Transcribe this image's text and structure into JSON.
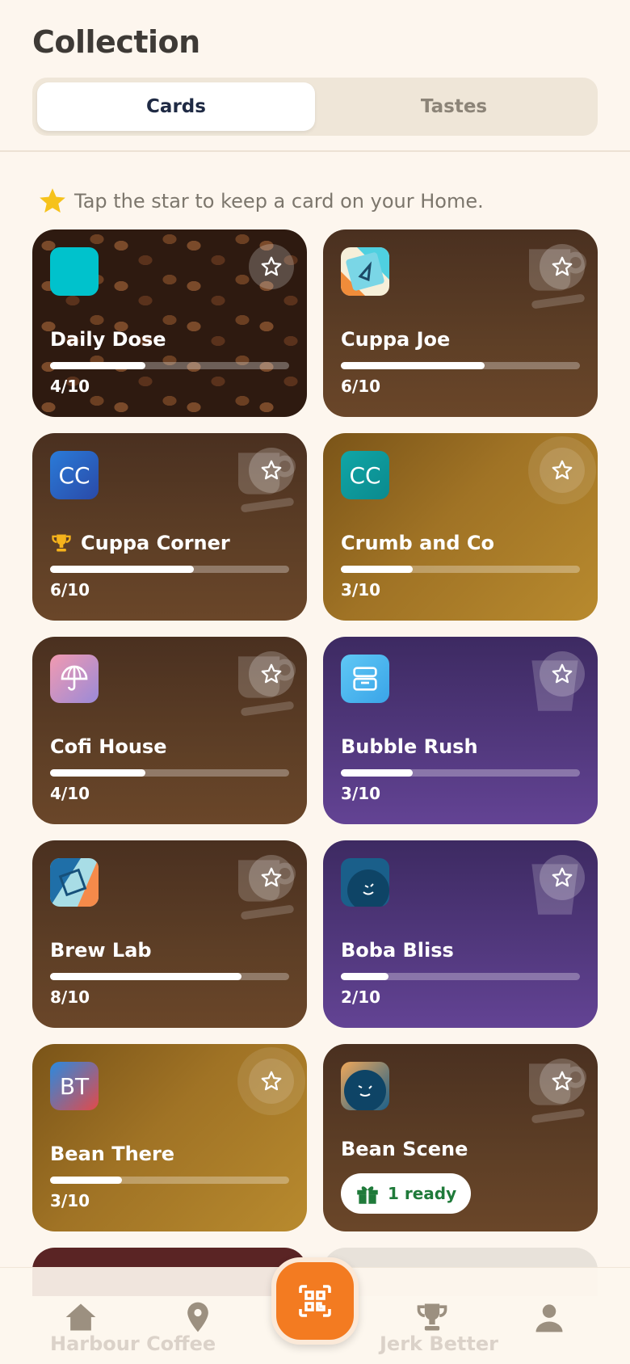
{
  "header": {
    "title": "Collection",
    "tabs": [
      {
        "label": "Cards",
        "active": true
      },
      {
        "label": "Tastes",
        "active": false
      }
    ]
  },
  "hint": {
    "icon": "star-icon",
    "text": "Tap the star to keep a card on your Home."
  },
  "cards": [
    {
      "name": "Daily Dose",
      "progress": "4/10",
      "fraction": 0.4,
      "theme": "beans",
      "logo": "teal-square-logo"
    },
    {
      "name": "Cuppa Joe",
      "progress": "6/10",
      "fraction": 0.6,
      "theme": "brown",
      "logo": "triangle-logo"
    },
    {
      "name": "Cuppa Corner",
      "progress": "6/10",
      "fraction": 0.6,
      "theme": "brown",
      "logo_text": "CC",
      "trophy": true
    },
    {
      "name": "Crumb and Co",
      "progress": "3/10",
      "fraction": 0.3,
      "theme": "gold",
      "logo_text": "CC"
    },
    {
      "name": "Cofi House",
      "progress": "4/10",
      "fraction": 0.4,
      "theme": "brown",
      "logo": "umbrella-logo"
    },
    {
      "name": "Bubble Rush",
      "progress": "3/10",
      "fraction": 0.3,
      "theme": "purple",
      "logo": "box-logo"
    },
    {
      "name": "Brew Lab",
      "progress": "8/10",
      "fraction": 0.8,
      "theme": "brown",
      "logo": "geometric-logo"
    },
    {
      "name": "Boba Bliss",
      "progress": "2/10",
      "fraction": 0.2,
      "theme": "purple",
      "logo": "face-logo"
    },
    {
      "name": "Bean There",
      "progress": "3/10",
      "fraction": 0.3,
      "theme": "gold",
      "logo_text": "BT"
    },
    {
      "name": "Bean Scene",
      "ready": "1 ready",
      "theme": "brown",
      "logo": "face-logo"
    }
  ],
  "peek_cards": [
    "Harbour Coffee",
    "Jerk Better"
  ],
  "nav": {
    "items": [
      "home-icon",
      "location-pin-icon",
      "qr-scan-icon",
      "trophy-icon",
      "profile-icon"
    ],
    "accent": "#f37b21"
  }
}
